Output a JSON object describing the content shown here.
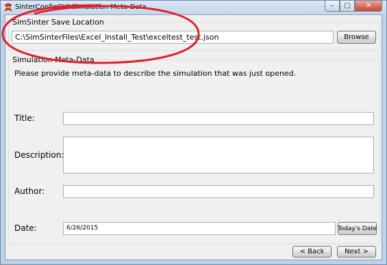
{
  "window": {
    "title": "SinterConfigGUI Simulation Meta-Data",
    "controls": {
      "minimize": "–",
      "maximize": "□",
      "close": "✕"
    }
  },
  "save_location": {
    "group_label": "SimSinter Save Location",
    "path_value": "C:\\SimSinterFiles\\Excel_Install_Test\\exceltest_test.json",
    "browse_label": "Browse"
  },
  "metadata": {
    "group_label": "Simulation Meta-Data",
    "instructions": "Please provide meta-data to describe the simulation that was just opened.",
    "title_label": "Title:",
    "title_value": "",
    "description_label": "Description:",
    "description_value": "",
    "author_label": "Author:",
    "author_value": "",
    "date_label": "Date:",
    "date_value": "6/26/2015",
    "todays_date_label": "Today's Date"
  },
  "navigation": {
    "back_label": "< Back",
    "next_label": "Next >"
  },
  "colors": {
    "annotation": "#e0202a",
    "window_frame": "#bcd0e6",
    "client_bg": "#f0f0f0"
  },
  "icons": [
    "app-icon",
    "minimize-icon",
    "maximize-icon",
    "close-icon"
  ]
}
